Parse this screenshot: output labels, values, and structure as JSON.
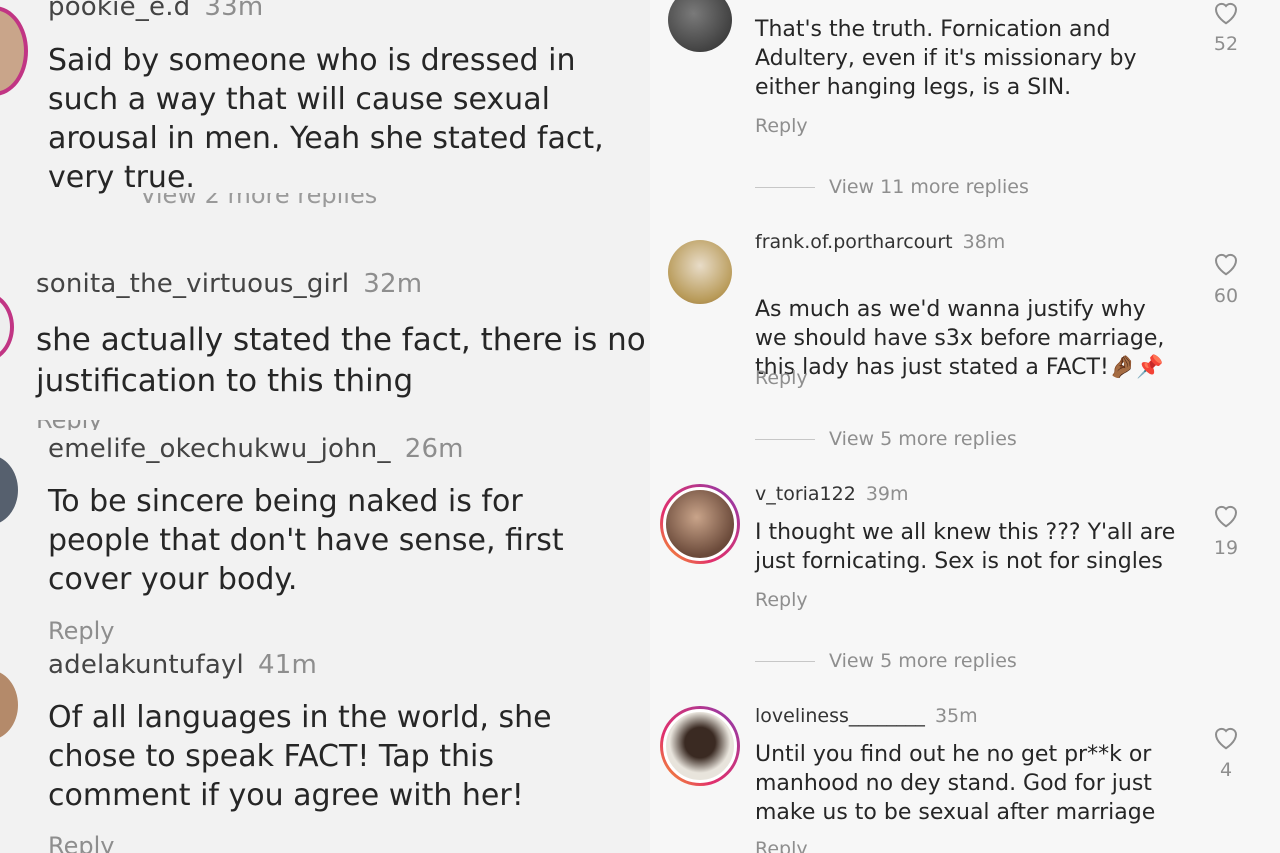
{
  "left": {
    "comments": [
      {
        "username": "pookie_e.d",
        "time": "33m",
        "text": "Said by someone who is dressed in\nsuch a way that will cause sexual\narousal in men. Yeah she stated fact,\nvery true.",
        "view_more": "View 2 more replies"
      },
      {
        "username": "sonita_the_virtuous_girl",
        "time": "32m",
        "text": "she actually stated the fact, there is no\njustification to this thing",
        "reply": "Reply"
      },
      {
        "username": "emelife_okechukwu_john_",
        "time": "26m",
        "text": "To be sincere being naked is for\npeople that don't have sense, first\ncover your body.",
        "reply": "Reply"
      },
      {
        "username": "adelakuntufayl",
        "time": "41m",
        "text": "Of all languages in the world, she\nchose to speak FACT! Tap this\ncomment if you agree with her!",
        "reply": "Reply"
      }
    ]
  },
  "right": {
    "comments": [
      {
        "username": "",
        "time": "",
        "text": "That's the truth. Fornication and\nAdultery, even if it's missionary by\neither hanging legs, is a SIN.",
        "reply": "Reply",
        "likes": "52",
        "view_more": "View 11 more replies"
      },
      {
        "username": "frank.of.portharcourt",
        "time": "38m",
        "text": "As much as we'd wanna justify why\nwe should have s3x before marriage,\nthis lady has just stated a FACT!",
        "emoji": "🤌🏾📌",
        "reply": "Reply",
        "likes": "60",
        "view_more": "View 5 more replies"
      },
      {
        "username": "v_toria122",
        "time": "39m",
        "text": "I thought we all knew this ??? Y'all are\njust fornicating.  Sex is not for singles",
        "reply": "Reply",
        "likes": "19",
        "view_more": "View 5 more replies"
      },
      {
        "username": "loveliness________",
        "time": "35m",
        "text": "Until you find out he no get pr**k or\nmanhood no dey stand. God for just\nmake us to be sexual after marriage",
        "reply": "Reply",
        "likes": "4"
      }
    ]
  },
  "colors": {
    "story_ring": "#c13584",
    "text": "#262626",
    "secondary": "#8e8e8e"
  }
}
